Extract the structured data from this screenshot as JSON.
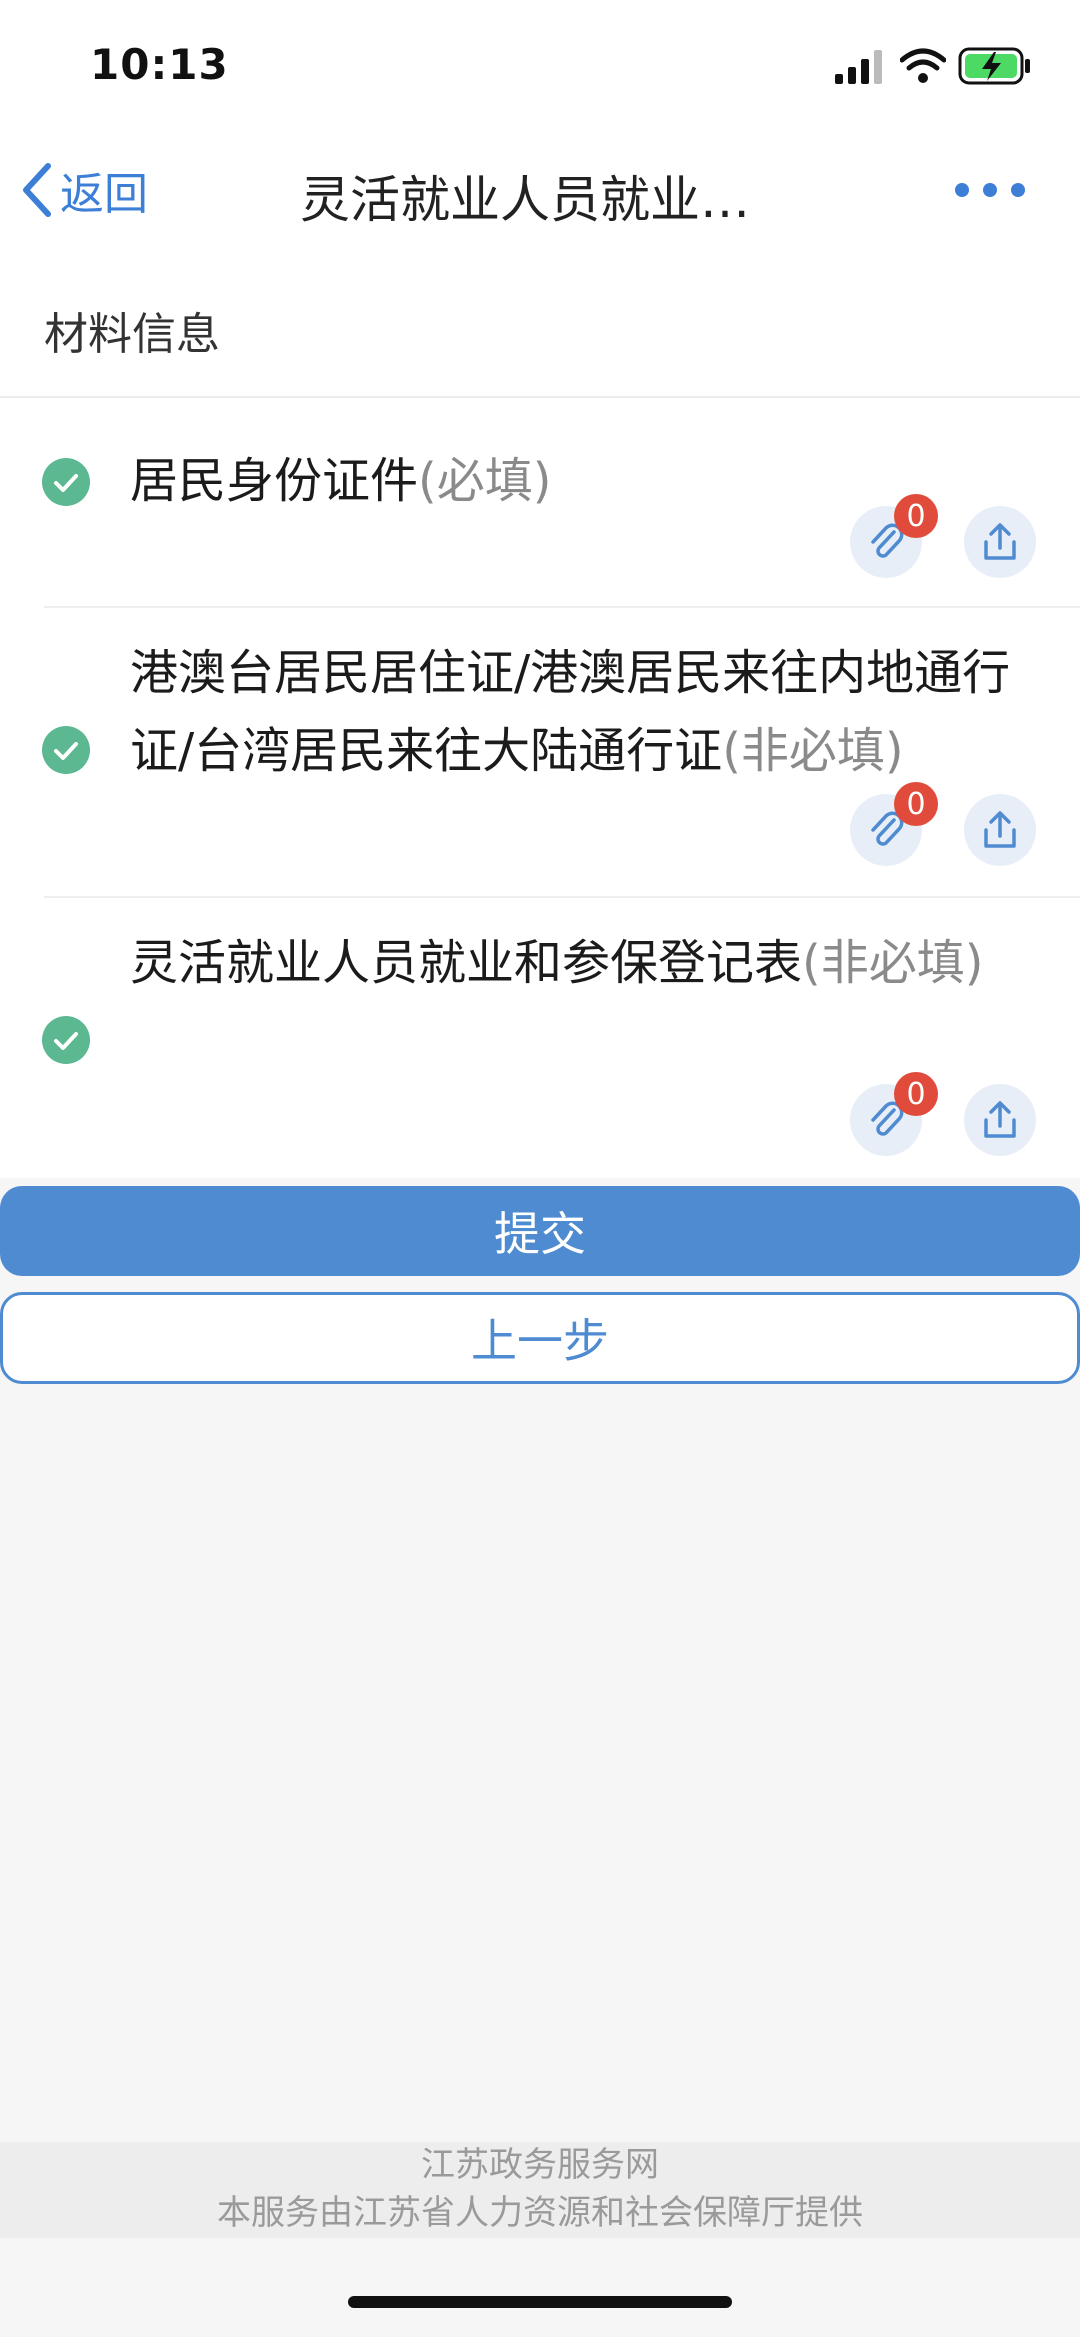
{
  "status_bar": {
    "time": "10:13",
    "icons": [
      "signal-icon",
      "wifi-icon",
      "battery-charging-icon"
    ],
    "battery_color": "#4cd964"
  },
  "nav": {
    "back_label": "返回",
    "title": "灵活就业人员就业…",
    "more_icon": "more-dots-icon"
  },
  "section": {
    "title": "材料信息"
  },
  "materials": [
    {
      "name": "居民身份证件",
      "required_label": "(必填)",
      "attachment_count": "0"
    },
    {
      "name": "港澳台居民居住证/港澳居民来往内地通行证/台湾居民来往大陆通行证",
      "required_label": "(非必填)",
      "attachment_count": "0"
    },
    {
      "name": "灵活就业人员就业和参保登记表",
      "required_label": "(非必填)",
      "attachment_count": "0"
    }
  ],
  "actions": {
    "submit_label": "提交",
    "previous_label": "上一步"
  },
  "footer": {
    "line1": "江苏政务服务网",
    "line2": "本服务由江苏省人力资源和社会保障厅提供"
  },
  "colors": {
    "accent": "#4f8bd1",
    "check": "#5cb890",
    "badge": "#e14b3b"
  }
}
